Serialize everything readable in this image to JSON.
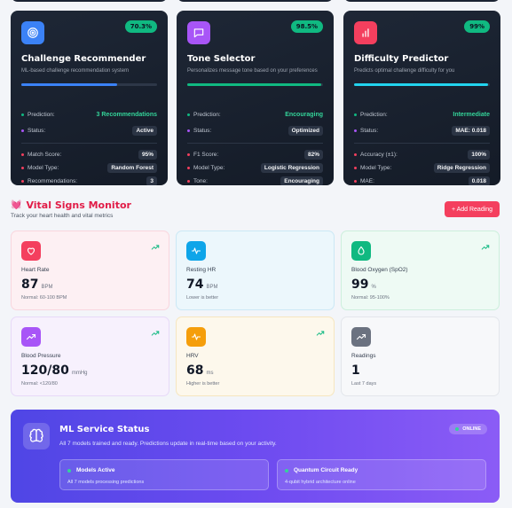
{
  "models": [
    {
      "title": "Challenge Recommender",
      "description": "ML-based challenge recommendation system",
      "badge": "70.3%",
      "progress": 0.703,
      "icon": "target-icon",
      "icon_color": "#3b82f6",
      "prediction": "3 Recommendations",
      "status": "Active",
      "metrics": [
        {
          "label": "Match Score:",
          "value": "95%"
        },
        {
          "label": "Model Type:",
          "value": "Random Forest"
        },
        {
          "label": "Recommendations:",
          "value": "3"
        }
      ]
    },
    {
      "title": "Tone Selector",
      "description": "Personalizes message tone based on your preferences",
      "badge": "98.5%",
      "progress": 0.985,
      "icon": "message-icon",
      "icon_color": "#a855f7",
      "prediction": "Encouraging",
      "status": "Optimized",
      "metrics": [
        {
          "label": "F1 Score:",
          "value": "82%"
        },
        {
          "label": "Model Type:",
          "value": "Logistic Regression"
        },
        {
          "label": "Tone:",
          "value": "Encouraging"
        }
      ]
    },
    {
      "title": "Difficulty Predictor",
      "description": "Predicts optimal challenge difficulty for you",
      "badge": "99%",
      "progress": 0.99,
      "icon": "bar-chart-icon",
      "icon_color": "#f43f5e",
      "prediction": "Intermediate",
      "status": "MAE: 0.018",
      "metrics": [
        {
          "label": "Accuracy (±1):",
          "value": "100%"
        },
        {
          "label": "Model Type:",
          "value": "Ridge Regression"
        },
        {
          "label": "MAE:",
          "value": "0.018"
        }
      ]
    }
  ],
  "labels": {
    "prediction": "Prediction:",
    "status": "Status:"
  },
  "vitals": {
    "title": "Vital Signs Monitor",
    "subtitle": "Track your heart health and vital metrics",
    "add_button": "+ Add Reading",
    "cards": [
      {
        "label": "Heart Rate",
        "value": "87",
        "unit": "BPM",
        "note": "Normal: 60-100 BPM",
        "icon": "heart-icon",
        "icon_color": "#f43f5e",
        "bg": "#fdf0f3",
        "border": "#f9d6de",
        "trend": true
      },
      {
        "label": "Resting HR",
        "value": "74",
        "unit": "BPM",
        "note": "Lower is better",
        "icon": "pulse-icon",
        "icon_color": "#0ea5e9",
        "bg": "#ecf7fc",
        "border": "#cbe8f5",
        "trend": false
      },
      {
        "label": "Blood Oxygen (SpO2)",
        "value": "99",
        "unit": "%",
        "note": "Normal: 95-100%",
        "icon": "droplet-icon",
        "icon_color": "#10b981",
        "bg": "#eefaf4",
        "border": "#ccefdc",
        "trend": true
      },
      {
        "label": "Blood Pressure",
        "value": "120/80",
        "unit": "mmHg",
        "note": "Normal: <120/80",
        "icon": "trend-icon",
        "icon_color": "#a855f7",
        "bg": "#f7f1fd",
        "border": "#e7d9f8",
        "trend": true
      },
      {
        "label": "HRV",
        "value": "68",
        "unit": "ms",
        "note": "Higher is better",
        "icon": "pulse-icon",
        "icon_color": "#f59e0b",
        "bg": "#fdf8ec",
        "border": "#f6e6bf",
        "trend": true
      },
      {
        "label": "Readings",
        "value": "1",
        "unit": "",
        "note": "Last 7 days",
        "icon": "trend-icon",
        "icon_color": "#6b7280",
        "bg": "#f7f8fa",
        "border": "#e3e6eb",
        "trend": false
      }
    ]
  },
  "service": {
    "title": "ML Service Status",
    "description": "All 7 models trained and ready. Predictions update in real-time based on your activity.",
    "online": "ONLINE",
    "boxes": [
      {
        "title": "Models Active",
        "desc": "All 7 models processing predictions"
      },
      {
        "title": "Quantum Circuit Ready",
        "desc": "4-qubit hybrid architecture online"
      }
    ]
  },
  "colors": {
    "accent_green": "#34d399",
    "progress_bar": [
      "#3b82f6",
      "#10b981",
      "#22d3ee"
    ],
    "vs_title": "#e11d48"
  }
}
